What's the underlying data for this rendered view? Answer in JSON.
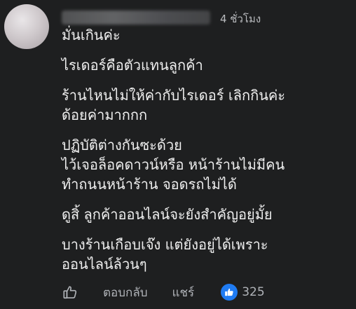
{
  "comment": {
    "author_name": "",
    "timestamp": "4 ชั่วโมง",
    "paragraphs": [
      [
        "มั่นเกินค่ะ"
      ],
      [
        "ไรเดอร์คือตัวแทนลูกค้า"
      ],
      [
        "ร้านไหนไม่ให้ค่ากับไรเดอร์ เลิกกินค่ะ",
        "ด้อยค่ามากกก"
      ],
      [
        "ปฏิบัติต่างกันซะด้วย",
        "ไว้เจอล็อคดาวน์หรือ หน้าร้านไม่มีคน",
        "ทำถนนหน้าร้าน จอดรถไม่ได้"
      ],
      [
        "ดูสิ้ ลูกค้าออนไลน์จะยังสำคัญอยู่มั้ย"
      ],
      [
        "บางร้านเกือบเจ๊ง แต่ยังอยู่ได้เพราะ",
        "ออนไลน์ล้วนๆ"
      ]
    ]
  },
  "actions": {
    "like_icon": "thumbs-up-outline-icon",
    "reply_label": "ตอบกลับ",
    "share_label": "แชร์",
    "reaction_icon": "like-reaction-icon",
    "reaction_count": "325"
  },
  "colors": {
    "background": "#1e1f20",
    "text": "#efefef",
    "muted": "#b0b3b8",
    "reaction_blue": "#1f7bf2"
  }
}
